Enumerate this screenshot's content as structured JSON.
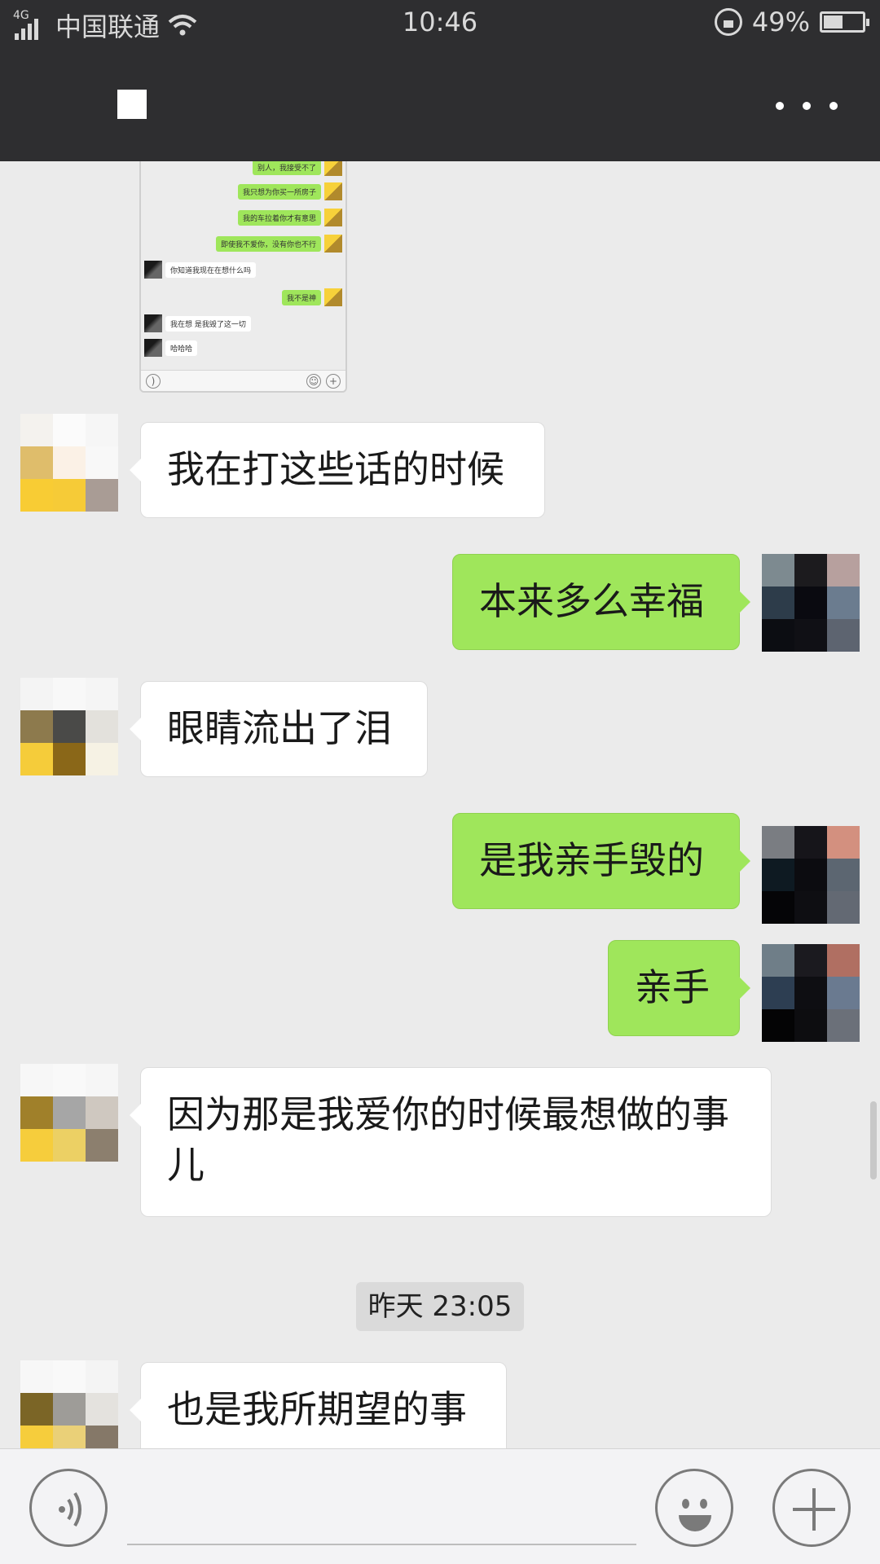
{
  "status_bar": {
    "network": "4G",
    "carrier": "中国联通",
    "time": "10:46",
    "battery": "49%",
    "battery_level": 0.49
  },
  "header": {
    "more_icon": "more-dots-icon"
  },
  "thumbnail": {
    "rows": [
      {
        "side": "right",
        "text": "别人，我接受不了"
      },
      {
        "side": "right",
        "text": "我只想为你买一所房子"
      },
      {
        "side": "right",
        "text": "我的车拉着你才有意思"
      },
      {
        "side": "right",
        "text": "即使我不爱你，没有你也不行"
      },
      {
        "side": "left",
        "text": "你知道我现在在想什么吗"
      },
      {
        "side": "right",
        "text": "我不是神"
      },
      {
        "side": "left",
        "text": "我在想 是我毁了这一切"
      },
      {
        "side": "left",
        "text": "哈哈哈"
      }
    ]
  },
  "messages": [
    {
      "side": "in",
      "text": "我在打这些话的时候"
    },
    {
      "side": "out",
      "text": "本来多么幸福"
    },
    {
      "side": "in",
      "text": "眼睛流出了泪"
    },
    {
      "side": "out",
      "text": "是我亲手毁的"
    },
    {
      "side": "out",
      "text": "亲手"
    },
    {
      "side": "in",
      "text": "因为那是我爱你的时候最想做的事儿"
    },
    {
      "side": "in",
      "text": "也是我所期望的事"
    }
  ],
  "timestamp": "昨天 23:05",
  "input_bar": {
    "voice_icon": "voice-icon",
    "emoji_icon": "emoji-icon",
    "plus_icon": "plus-icon"
  }
}
